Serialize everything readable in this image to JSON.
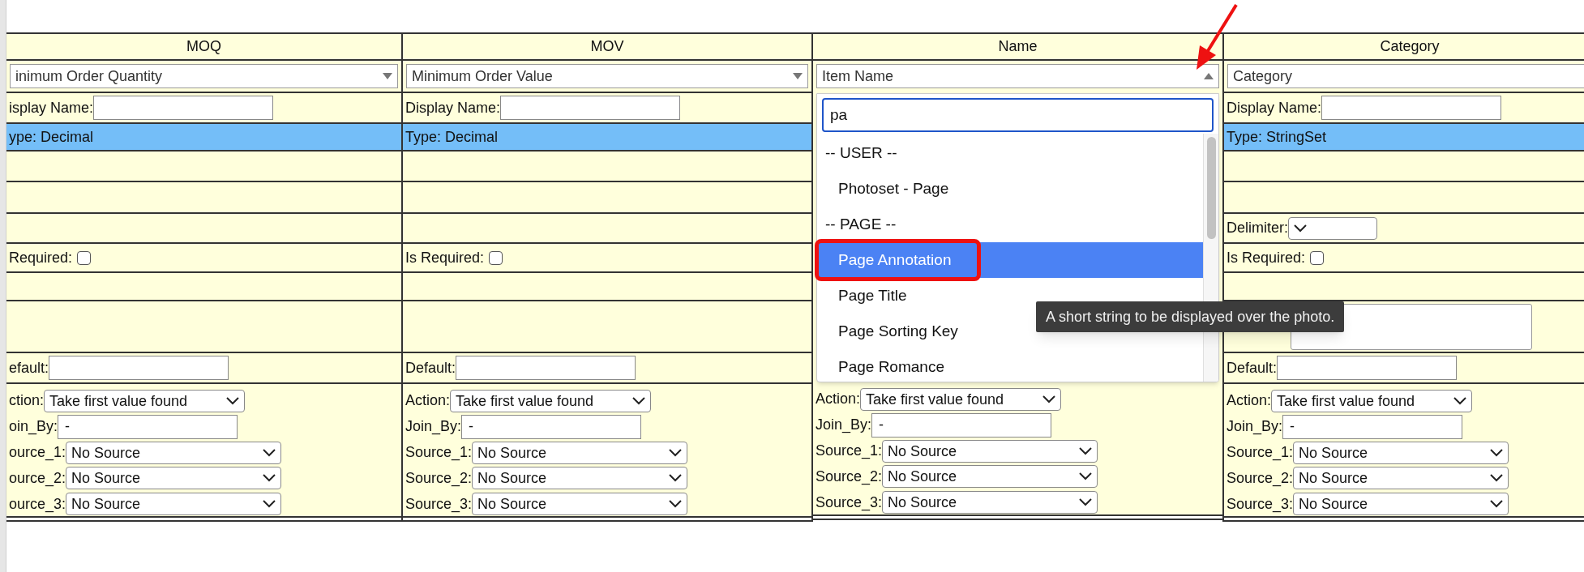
{
  "columns": [
    {
      "header": "MOQ",
      "field": {
        "value": "inimum Order Quantity"
      },
      "cells": [
        {
          "kind": "text_input",
          "label": "isplay Name:"
        },
        {
          "kind": "type",
          "label": "ype: Decimal"
        },
        {
          "kind": "empty"
        },
        {
          "kind": "empty"
        },
        {
          "kind": "empty"
        },
        {
          "kind": "checkbox",
          "label": "Required:",
          "checked": false
        },
        {
          "kind": "empty"
        },
        {
          "kind": "empty"
        },
        {
          "kind": "text_input",
          "label": "efault:"
        }
      ],
      "action": {
        "label": "ction:",
        "value": "Take first value found"
      },
      "join_by": {
        "label": "oin_By:",
        "value": "-"
      },
      "sources": [
        {
          "label": "ource_1:",
          "value": "No Source"
        },
        {
          "label": "ource_2:",
          "value": "No Source"
        },
        {
          "label": "ource_3:",
          "value": "No Source"
        }
      ]
    },
    {
      "header": "MOV",
      "field": {
        "value": "Minimum Order Value"
      },
      "cells": [
        {
          "kind": "text_input",
          "label": "Display Name:"
        },
        {
          "kind": "type",
          "label": "Type: Decimal"
        },
        {
          "kind": "empty"
        },
        {
          "kind": "empty"
        },
        {
          "kind": "empty"
        },
        {
          "kind": "checkbox",
          "label": "Is Required:",
          "checked": false
        },
        {
          "kind": "empty"
        },
        {
          "kind": "empty"
        },
        {
          "kind": "text_input",
          "label": "Default:"
        }
      ],
      "action": {
        "label": "Action:",
        "value": "Take first value found"
      },
      "join_by": {
        "label": "Join_By:",
        "value": "-"
      },
      "sources": [
        {
          "label": "Source_1:",
          "value": "No Source"
        },
        {
          "label": "Source_2:",
          "value": "No Source"
        },
        {
          "label": "Source_3:",
          "value": "No Source"
        }
      ]
    },
    {
      "header": "Name",
      "field": {
        "value": "Item Name",
        "expanded": true
      },
      "dropdown": {
        "search": "pa",
        "options": [
          {
            "kind": "group",
            "label": "-- USER --"
          },
          {
            "kind": "option",
            "label": "Photoset - Page",
            "selected": false
          },
          {
            "kind": "group",
            "label": "-- PAGE --"
          },
          {
            "kind": "option",
            "label": "Page Annotation",
            "selected": true
          },
          {
            "kind": "option",
            "label": "Page Title",
            "selected": false
          },
          {
            "kind": "option",
            "label": "Page Sorting Key",
            "selected": false
          },
          {
            "kind": "option",
            "label": "Page Romance",
            "selected": false
          }
        ]
      },
      "action": {
        "label": "Action:",
        "value": "Take first value found"
      },
      "join_by": {
        "label": "Join_By:",
        "value": "-"
      },
      "sources": [
        {
          "label": "Source_1:",
          "value": "No Source"
        },
        {
          "label": "Source_2:",
          "value": "No Source"
        },
        {
          "label": "Source_3:",
          "value": "No Source"
        }
      ]
    },
    {
      "header": "Category",
      "field": {
        "value": "Category"
      },
      "cells": [
        {
          "kind": "text_input",
          "label": "Display Name:"
        },
        {
          "kind": "type",
          "label": "Type: StringSet"
        },
        {
          "kind": "empty"
        },
        {
          "kind": "empty"
        },
        {
          "kind": "select",
          "label": "Delimiter:"
        },
        {
          "kind": "checkbox",
          "label": "Is Required:",
          "checked": false
        },
        {
          "kind": "empty"
        },
        {
          "kind": "textarea"
        },
        {
          "kind": "text_input",
          "label": "Default:"
        }
      ],
      "action": {
        "label": "Action:",
        "value": "Take first value found"
      },
      "join_by": {
        "label": "Join_By:",
        "value": "-"
      },
      "sources": [
        {
          "label": "Source_1:",
          "value": "No Source"
        },
        {
          "label": "Source_2:",
          "value": "No Source"
        },
        {
          "label": "Source_3:",
          "value": "No Source"
        }
      ]
    }
  ],
  "tooltip": "A short string to be displayed over the photo."
}
